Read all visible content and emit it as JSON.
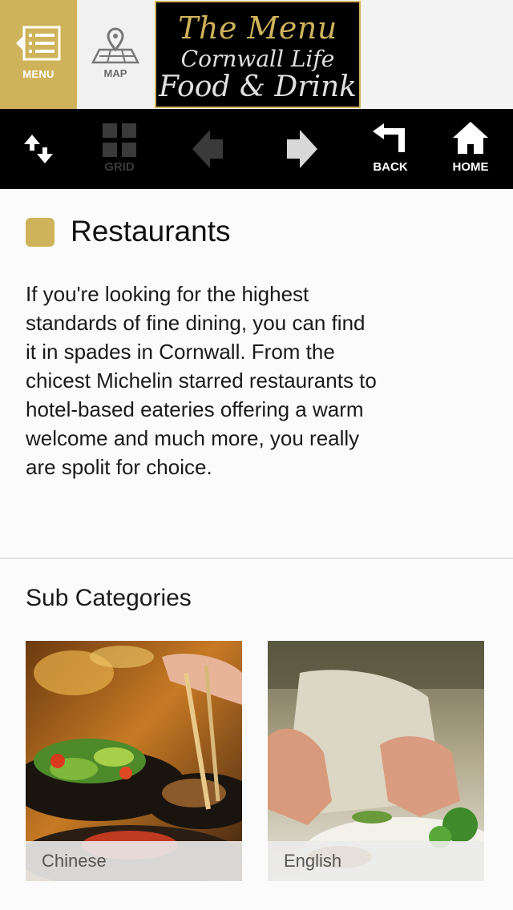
{
  "top_bar": {
    "menu_label": "MENU",
    "map_label": "MAP",
    "logo": {
      "line1": "The Menu",
      "line2": "Cornwall Life",
      "line3": "Food & Drink"
    }
  },
  "nav_bar": {
    "grid_label": "GRID",
    "back_label": "BACK",
    "home_label": "HOME"
  },
  "section": {
    "title": "Restaurants",
    "description": "If you're looking for the highest standards of fine dining, you can find it in spades in Cornwall. From the chicest Michelin starred restaurants to hotel-based eateries offering a warm welcome and much more, you really are spolit for choice."
  },
  "sub_categories": {
    "heading": "Sub Categories",
    "items": [
      {
        "label": "Chinese"
      },
      {
        "label": "English"
      }
    ]
  },
  "colors": {
    "accent_gold": "#cfb35a",
    "nav_bg": "#000000"
  }
}
